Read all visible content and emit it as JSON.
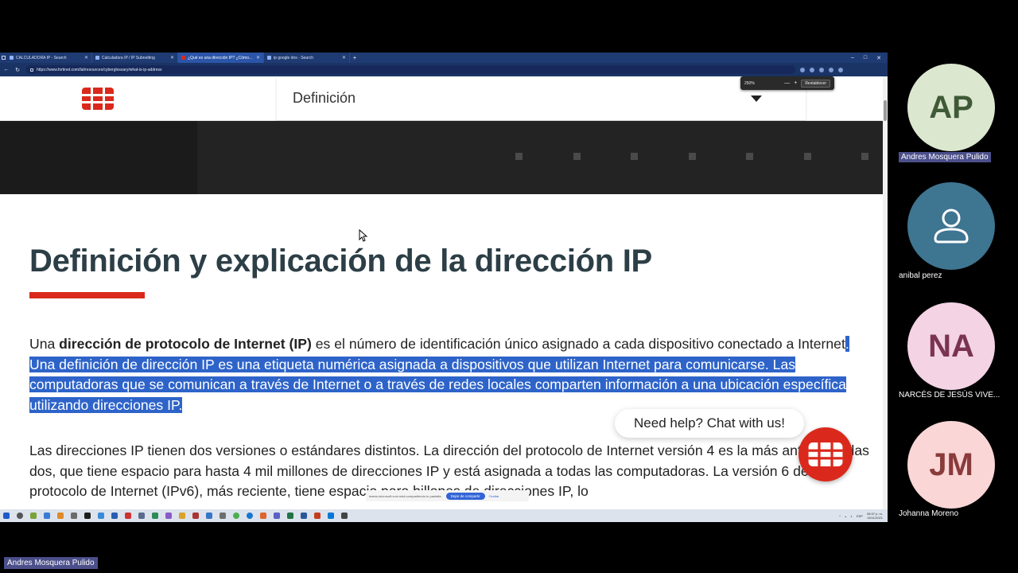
{
  "browser": {
    "tabs": [
      {
        "label": "CALCULADORA IP - Search",
        "active": false
      },
      {
        "label": "Calculadora IP / IP Subnetting",
        "active": false
      },
      {
        "label": "¿Qué es una dirección IP? ¿Cómo...",
        "active": true
      },
      {
        "label": "ip google dns - Search",
        "active": false
      }
    ],
    "new_tab": "+",
    "window_controls": [
      "–",
      "□",
      "✕"
    ],
    "url": "https://www.fortinet.com/lat/resources/cyberglossary/what-is-ip-address",
    "zoom": {
      "value": "250%",
      "minus": "—",
      "plus": "+",
      "reset_label": "Restablecer"
    }
  },
  "site": {
    "nav_select_label": "Definición",
    "brand_color": "#da291c"
  },
  "article": {
    "title": "Definición y explicación de la dirección IP",
    "p1": {
      "intro": "Una ",
      "bold": "dirección de protocolo de Internet (IP)",
      "rest": " es el número de identificación único asignado a cada dispositivo conectado a Internet",
      "highlighted": ". Una definición de dirección IP es una etiqueta numérica asignada a dispositivos que utilizan Internet para comunicarse. Las computadoras que se comunican a través de Internet o a través de redes locales comparten información a una ubicación específica utilizando direcciones IP."
    },
    "p2": "Las direcciones IP tienen dos versiones o estándares distintos. La dirección del protocolo de Internet versión 4 es la más antigua de las dos, que tiene espacio para hasta 4 mil millones de direcciones IP y está asignada a todas las computadoras. La versión 6 del protocolo de Internet (IPv6), más reciente, tiene espacio para billones de direcciones IP, lo"
  },
  "chat": {
    "bubble_text": "Need help? Chat with us!"
  },
  "sharebar": {
    "message": "teams.microsoft.com está compartiendo tu pantalla.",
    "stop_label": "Dejar de compartir",
    "hide_label": "Ocultar"
  },
  "taskbar": {
    "lang": "ESP",
    "time": "08:37 p. m.",
    "date": "16/11/2021"
  },
  "participants": [
    {
      "initials": "AP",
      "name": "Andres Mosquera Pulido"
    },
    {
      "initials": "",
      "name": "anibal perez"
    },
    {
      "initials": "NA",
      "name": "NARCÉS DE JESÚS VIVE..."
    },
    {
      "initials": "JM",
      "name": "Johanna Moreno"
    }
  ],
  "presenter_label": "Andres Mosquera Pulido",
  "colors": {
    "highlight": "#2e64c9",
    "title": "#2c3e46",
    "browser_chrome": "#1f3b73"
  }
}
